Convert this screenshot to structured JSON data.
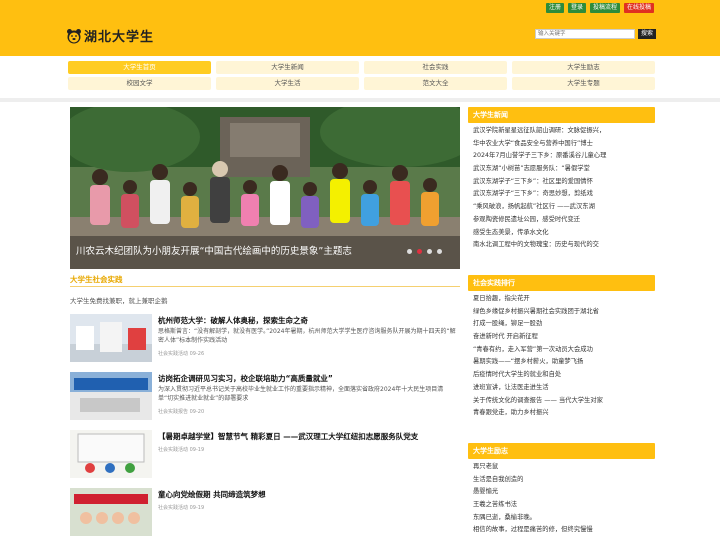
{
  "toplinks": [
    "注册",
    "登录",
    "投稿流程",
    "在线投稿"
  ],
  "logo": {
    "text": "湖北大学生"
  },
  "search": {
    "placeholder": "输入关键字",
    "button": "搜索"
  },
  "nav": [
    {
      "label": "大学生首页",
      "active": true
    },
    {
      "label": "大学生新闻"
    },
    {
      "label": "社会实践"
    },
    {
      "label": "大学生励志"
    },
    {
      "label": "校园文学"
    },
    {
      "label": "大学生活"
    },
    {
      "label": "范文大全"
    },
    {
      "label": "大学生专题"
    }
  ],
  "banner": {
    "caption": "川农云木纪团队为小朋友开展“中国古代绘画中的历史景象”主题志",
    "slide_count": 4,
    "active_slide": 2
  },
  "section": {
    "title": "大学生社会实践",
    "desc": "大学生免费找兼职，就上兼职企鹅"
  },
  "articles": [
    {
      "title": "杭州师范大学：破解人体奥秘，探索生命之奇",
      "desc": "思格斯曾言：“没有解剖学，就没有医学。”2024年暑期，杭州师范大学学生医疗咨询服务队开展为期十四天的“解密人体”标本制作实践活动",
      "meta": "社会实践活动 09-26"
    },
    {
      "title": "访岗拓企调研见习实习，校企联培助力“高质量就业”",
      "desc": "为深入贯彻习近平总书记关于高校毕业生就业工作的重要指示精神，全面落实省政府2024年十大民生项目清单“切实推进就业就业”的部署要求",
      "meta": "社会实践报告 09-20"
    },
    {
      "title": "【暑期卓越学堂】智慧节气 精彩夏日 ——武汉理工大学红纽扣志愿服务队党支",
      "desc": "",
      "meta": "社会实践活动 09-19"
    },
    {
      "title": "童心向党绘假期 共同缔造筑梦想",
      "desc": "",
      "meta": "社会实践活动 09-19"
    }
  ],
  "panels": [
    {
      "title": "大学生新闻",
      "items": [
        "武汉学院新星星远征队韶山调研：文脉促振兴，",
        "华中农业大学“食品安全与营养中国行”博士",
        "2024年7月山誉学子三下乡：原番溪谷儿童心理",
        "武汉东湖“小树苗”志愿服务队：“暑假学堂",
        "武汉东湖学子“三下乡”：社区里的爱国情怀",
        "武汉东湖学子“三下乡”：奇思妙想，剪纸戏",
        "“乘风破浪，扬帆起航”社区行 ——武汉东湖",
        "参观陶瓷修民遗址公园，感受时代变迁",
        "感受生态美景，传承水文化",
        "南水北调工程中的文物瑰宝：历史与现代的交"
      ]
    },
    {
      "title": "社会实践排行",
      "items": [
        "夏日拾趣，指尖花开",
        "绿色乡缘促乡村振兴暑期社会实践团于湖北省",
        "打成一股绳，铆足一股劲",
        "奋进新时代 开启新征程",
        "“青春有约，走入军营”第一次动员大会成功",
        "暑期实践——“摆乡村薪火，助童梦飞扬",
        "后疫情时代大学生的就业和自处",
        "进班宣讲，让法医走进生活",
        "关于传统文化的调查报告 —— 当代大学生对家",
        "青春跟党走，助力乡村振兴"
      ]
    },
    {
      "title": "大学生励志",
      "items": [
        "再只老鼠",
        "生活是自我创造的",
        "愚婴愉光",
        "王羲之苦练书法",
        "东隅已逝，桑榆非晚。",
        "相信的故事，过程是痛苦的修，但终究慢慢"
      ]
    }
  ]
}
